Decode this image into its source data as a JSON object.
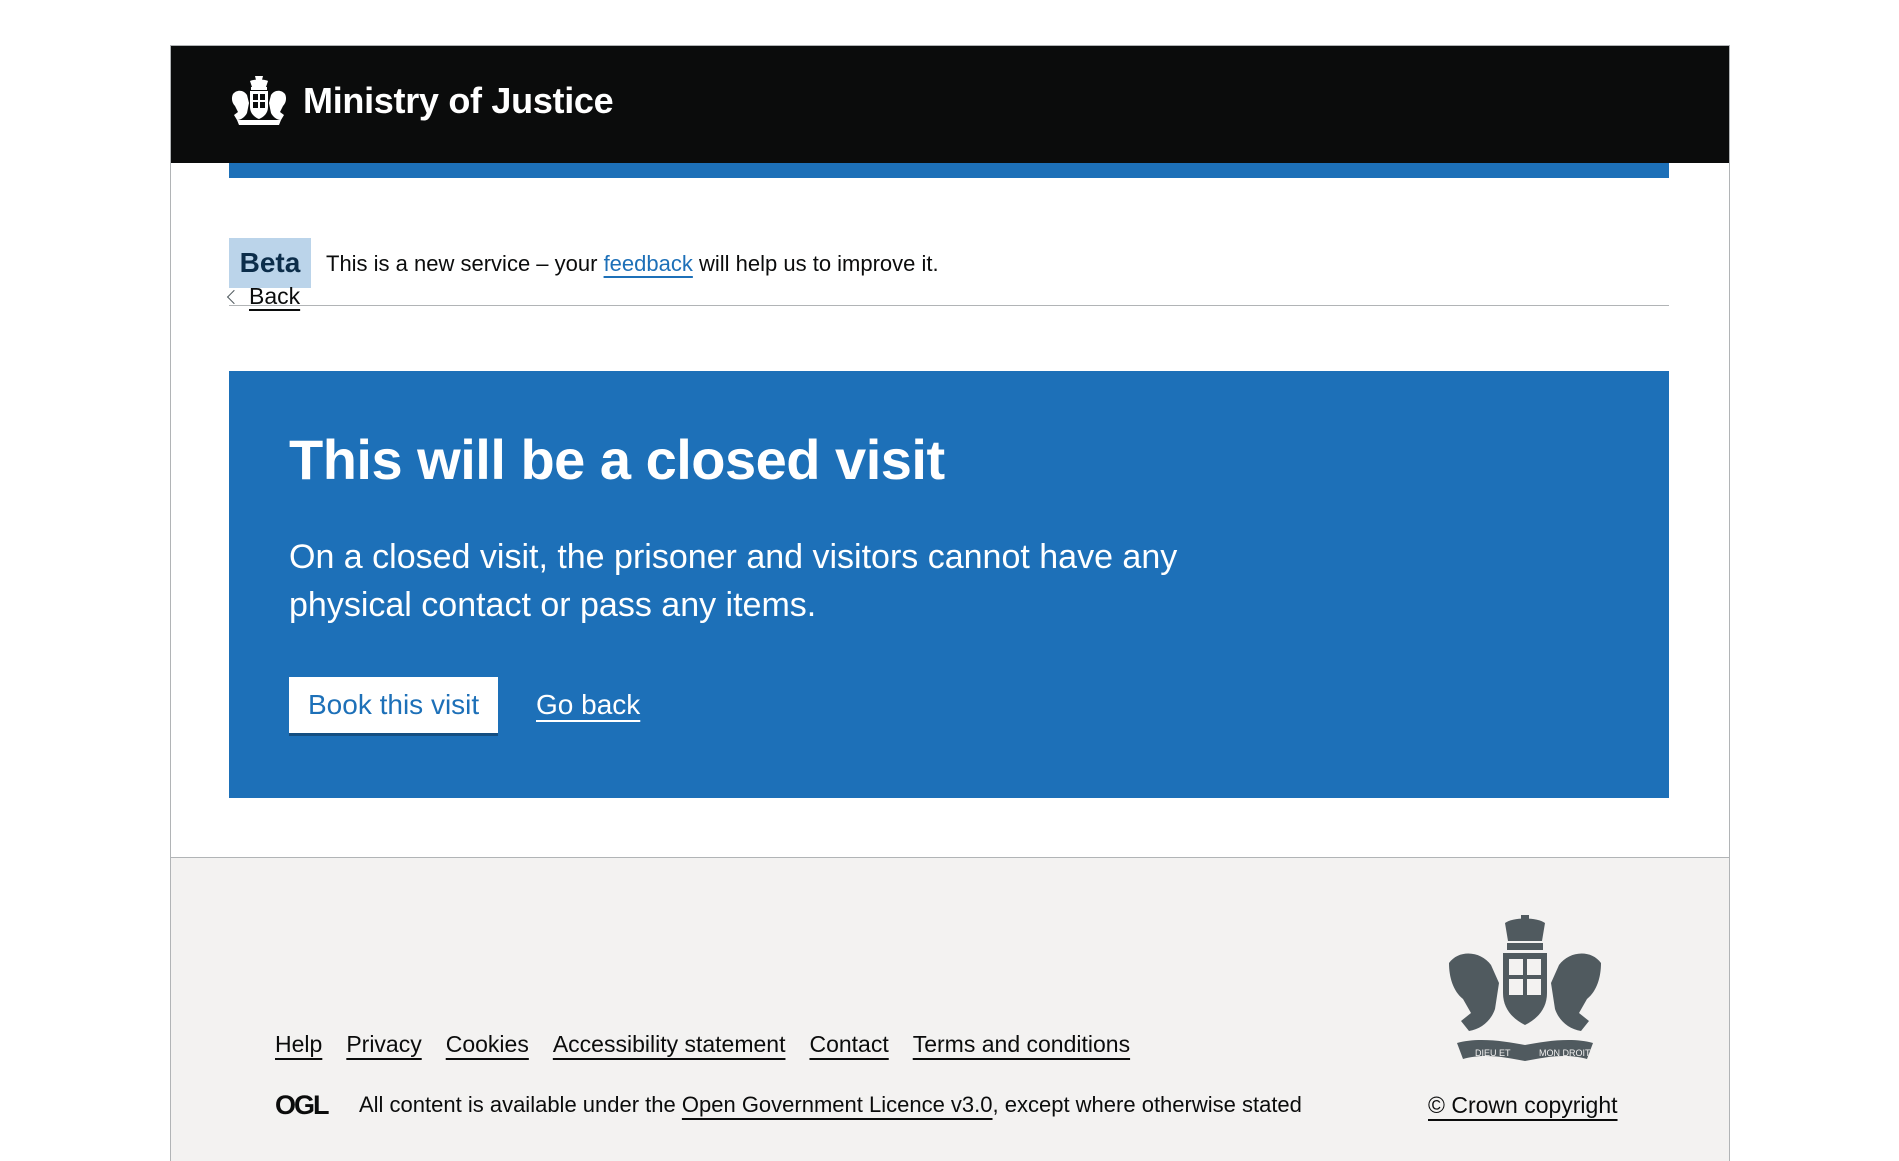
{
  "header": {
    "title": "Ministry of Justice",
    "brand_color": "#0b0c0c",
    "accent_color": "#1d70b8"
  },
  "phase_banner": {
    "tag": "Beta",
    "text_before": "This is a new service – your",
    "link": "feedback",
    "text_after": "will help us to improve it."
  },
  "back_link": "Back",
  "panel": {
    "title": "This will be a closed visit",
    "body": "On a closed visit, the prisoner and visitors cannot have any physical contact or pass any items.",
    "primary_button": "Book this visit",
    "secondary_link": "Go back",
    "background_color": "#1d70b8"
  },
  "footer": {
    "links": [
      "Help",
      "Privacy",
      "Cookies",
      "Accessibility statement",
      "Contact",
      "Terms and conditions"
    ],
    "licence_before": "All content is available under the",
    "licence_link": "Open Government Licence v3.0",
    "licence_after": ", except where otherwise stated",
    "copyright": "© Crown copyright",
    "crest_motto_left": "DIEU ET",
    "crest_motto_right": "MON DROIT",
    "ogl_logo_text": "OGL",
    "icons": [
      "royal-crest-icon",
      "ogl-logo-icon"
    ]
  }
}
